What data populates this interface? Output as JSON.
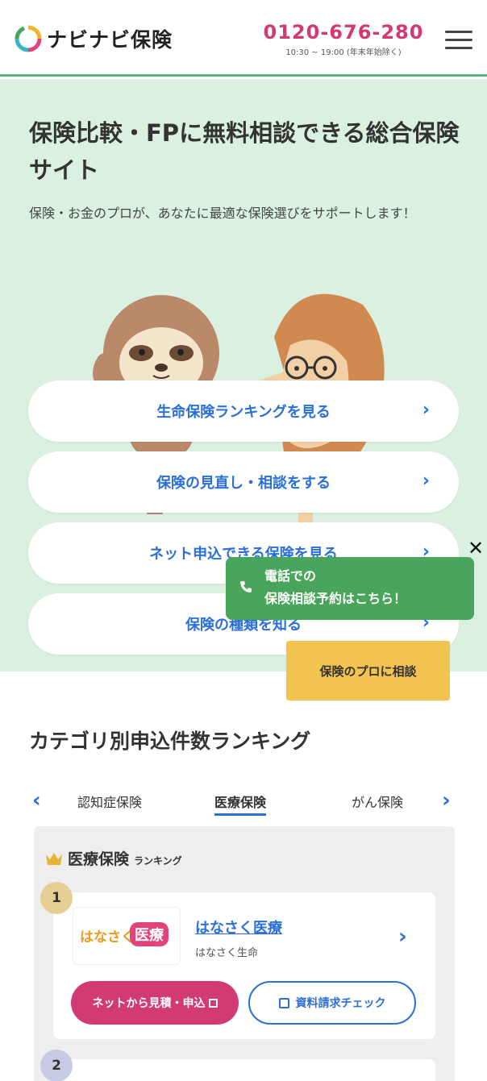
{
  "header": {
    "logo_text": "ナビナビ保険",
    "phone_number": "0120-676-280",
    "phone_hours": "10:30 ~ 19:00 (年末年始除く)"
  },
  "hero": {
    "title": "保険比較・FPに無料相談できる総合保険サイト",
    "subtitle": "保険・お金のプロが、あなたに最適な保険選びをサポートします！",
    "buttons": [
      {
        "label": "生命保険ランキングを見る"
      },
      {
        "label": "保険の見直し・相談をする"
      },
      {
        "label": "ネット申込できる保険を見る"
      },
      {
        "label": "保険の種類を知る"
      }
    ]
  },
  "popup": {
    "line1": "電話での",
    "line2": "保険相談予約はこちら！",
    "close": "✕"
  },
  "pro_button": {
    "label": "保険のプロに相談"
  },
  "ranking": {
    "title": "カテゴリ別申込件数ランキング",
    "tabs": [
      {
        "label": "認知症保険"
      },
      {
        "label": "医療保険"
      },
      {
        "label": "がん保険"
      }
    ],
    "active_tab": "医療保険",
    "panel_title": "医療保険",
    "panel_subtitle": "ランキング",
    "items": [
      {
        "rank": "1",
        "logo_part1": "はなさく",
        "logo_part2": "医療",
        "name": "はなさく医療",
        "company": "はなさく生命",
        "apply_label": "ネットから見積・申込",
        "doc_label": "資料請求チェック"
      },
      {
        "rank": "2"
      }
    ]
  },
  "colors": {
    "accent_green": "#5ab47d",
    "hero_bg": "#daf1e2",
    "link_blue": "#2a6fdb",
    "brand_pink": "#d23a74",
    "popup_green": "#4aa55c",
    "cta_yellow": "#f3c350"
  }
}
